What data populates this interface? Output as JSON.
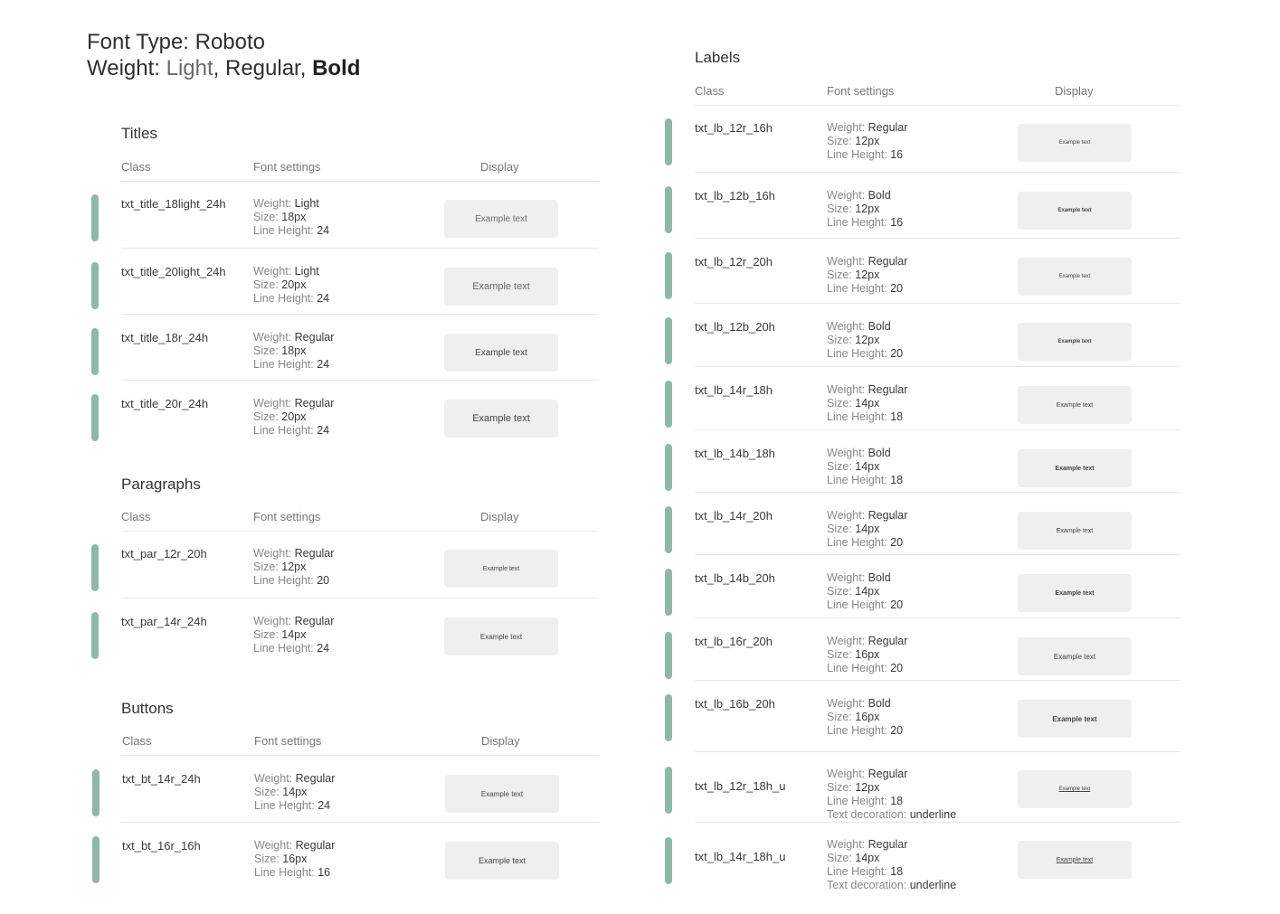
{
  "header": {
    "line1": "Font Type: Roboto",
    "weight_label": "Weight:",
    "weight_light": "Light",
    "sep1": ",",
    "weight_regular": "Regular,",
    "weight_bold": "Bold"
  },
  "labels": {
    "weight": "Weight:",
    "size": "Size:",
    "line_height": "Line Height:",
    "text_decoration": "Text decoration:"
  },
  "columns": {
    "class": "Class",
    "font_settings": "Font settings",
    "display": "Display"
  },
  "sections": {
    "titles": {
      "title": "Titles",
      "rows": [
        {
          "cls": "txt_title_18light_24h",
          "weight": "Light",
          "size": "18px",
          "lh": "24",
          "example": "Example text"
        },
        {
          "cls": "txt_title_20light_24h",
          "weight": "Light",
          "size": "20px",
          "lh": "24",
          "example": "Example text"
        },
        {
          "cls": "txt_title_18r_24h",
          "weight": "Regular",
          "size": "18px",
          "lh": "24",
          "example": "Example text"
        },
        {
          "cls": "txt_title_20r_24h",
          "weight": "Regular",
          "size": "20px",
          "lh": "24",
          "example": "Example text"
        }
      ]
    },
    "paragraphs": {
      "title": "Paragraphs",
      "rows": [
        {
          "cls": "txt_par_12r_20h",
          "weight": "Regular",
          "size": "12px",
          "lh": "20",
          "example": "Example text"
        },
        {
          "cls": "txt_par_14r_24h",
          "weight": "Regular",
          "size": "14px",
          "lh": "24",
          "example": "Example text"
        }
      ]
    },
    "buttons": {
      "title": "Buttons",
      "rows": [
        {
          "cls": "txt_bt_14r_24h",
          "weight": "Regular",
          "size": "14px",
          "lh": "24",
          "example": "Example text"
        },
        {
          "cls": "txt_bt_16r_16h",
          "weight": "Regular",
          "size": "16px",
          "lh": "16",
          "example": "Example text"
        }
      ]
    },
    "labels": {
      "title": "Labels",
      "rows": [
        {
          "cls": "txt_lb_12r_16h",
          "weight": "Regular",
          "size": "12px",
          "lh": "16",
          "example": "Example text"
        },
        {
          "cls": "txt_lb_12b_16h",
          "weight": "Bold",
          "size": "12px",
          "lh": "16",
          "example": "Example text"
        },
        {
          "cls": "txt_lb_12r_20h",
          "weight": "Regular",
          "size": "12px",
          "lh": "20",
          "example": "Example text"
        },
        {
          "cls": "txt_lb_12b_20h",
          "weight": "Bold",
          "size": "12px",
          "lh": "20",
          "example": "Example text"
        },
        {
          "cls": "txt_lb_14r_18h",
          "weight": "Regular",
          "size": "14px",
          "lh": "18",
          "example": "Example text"
        },
        {
          "cls": "txt_lb_14b_18h",
          "weight": "Bold",
          "size": "14px",
          "lh": "18",
          "example": "Example text"
        },
        {
          "cls": "txt_lb_14r_20h",
          "weight": "Regular",
          "size": "14px",
          "lh": "20",
          "example": "Example text"
        },
        {
          "cls": "txt_lb_14b_20h",
          "weight": "Bold",
          "size": "14px",
          "lh": "20",
          "example": "Example text"
        },
        {
          "cls": "txt_lb_16r_20h",
          "weight": "Regular",
          "size": "16px",
          "lh": "20",
          "example": "Example text"
        },
        {
          "cls": "txt_lb_16b_20h",
          "weight": "Bold",
          "size": "16px",
          "lh": "20",
          "example": "Example text"
        },
        {
          "cls": "txt_lb_12r_18h_u",
          "weight": "Regular",
          "size": "12px",
          "lh": "18",
          "decoration": "underline",
          "example": "Example text"
        },
        {
          "cls": "txt_lb_14r_18h_u",
          "weight": "Regular",
          "size": "14px",
          "lh": "18",
          "decoration": "underline",
          "example": "Example text"
        }
      ]
    }
  },
  "colors": {
    "accent": "#8fb9a6",
    "display_bg": "#efefef",
    "divider": "#e6e6e6"
  }
}
